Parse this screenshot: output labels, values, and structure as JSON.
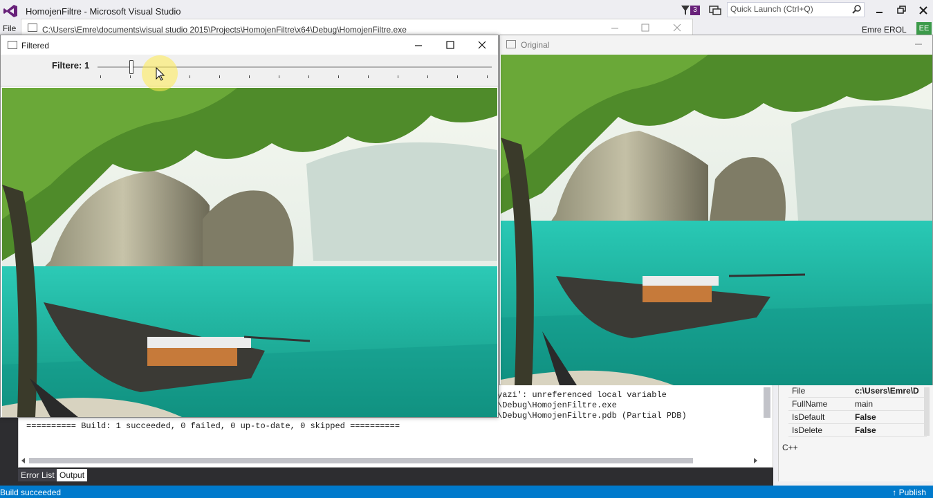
{
  "vs": {
    "title": "HomojenFiltre - Microsoft Visual Studio",
    "notification_count": "3",
    "quick_launch_placeholder": "Quick Launch (Ctrl+Q)",
    "menu_file": "File",
    "user_name": "Emre EROL",
    "user_initials": "EE"
  },
  "console": {
    "path": "C:\\Users\\Emre\\documents\\visual studio 2015\\Projects\\HomojenFiltre\\x64\\Debug\\HomojenFiltre.exe"
  },
  "filtered_window": {
    "title": "Filtered",
    "trackbar_label": "Filtere: 1",
    "trackbar_value": 1
  },
  "original_window": {
    "title": "Original"
  },
  "output": {
    "lines": [
      "yazi': unreferenced local variable",
      "\\Debug\\HomojenFiltre.exe",
      "\\Debug\\HomojenFiltre.pdb (Partial PDB)",
      "========== Build: 1 succeeded, 0 failed, 0 up-to-date, 0 skipped =========="
    ],
    "tabs": [
      "Error List",
      "Output"
    ]
  },
  "properties": {
    "rows": [
      {
        "key": "File",
        "value": "c:\\Users\\Emre\\D"
      },
      {
        "key": "FullName",
        "value": "main"
      },
      {
        "key": "IsDefault",
        "value": "False"
      },
      {
        "key": "IsDelete",
        "value": "False"
      }
    ],
    "description": "C++"
  },
  "status": {
    "message": "Build succeeded",
    "publish": "Publish"
  },
  "colors": {
    "accent": "#007acc",
    "vs_purple": "#68217a",
    "water": "#1fb7a8"
  }
}
